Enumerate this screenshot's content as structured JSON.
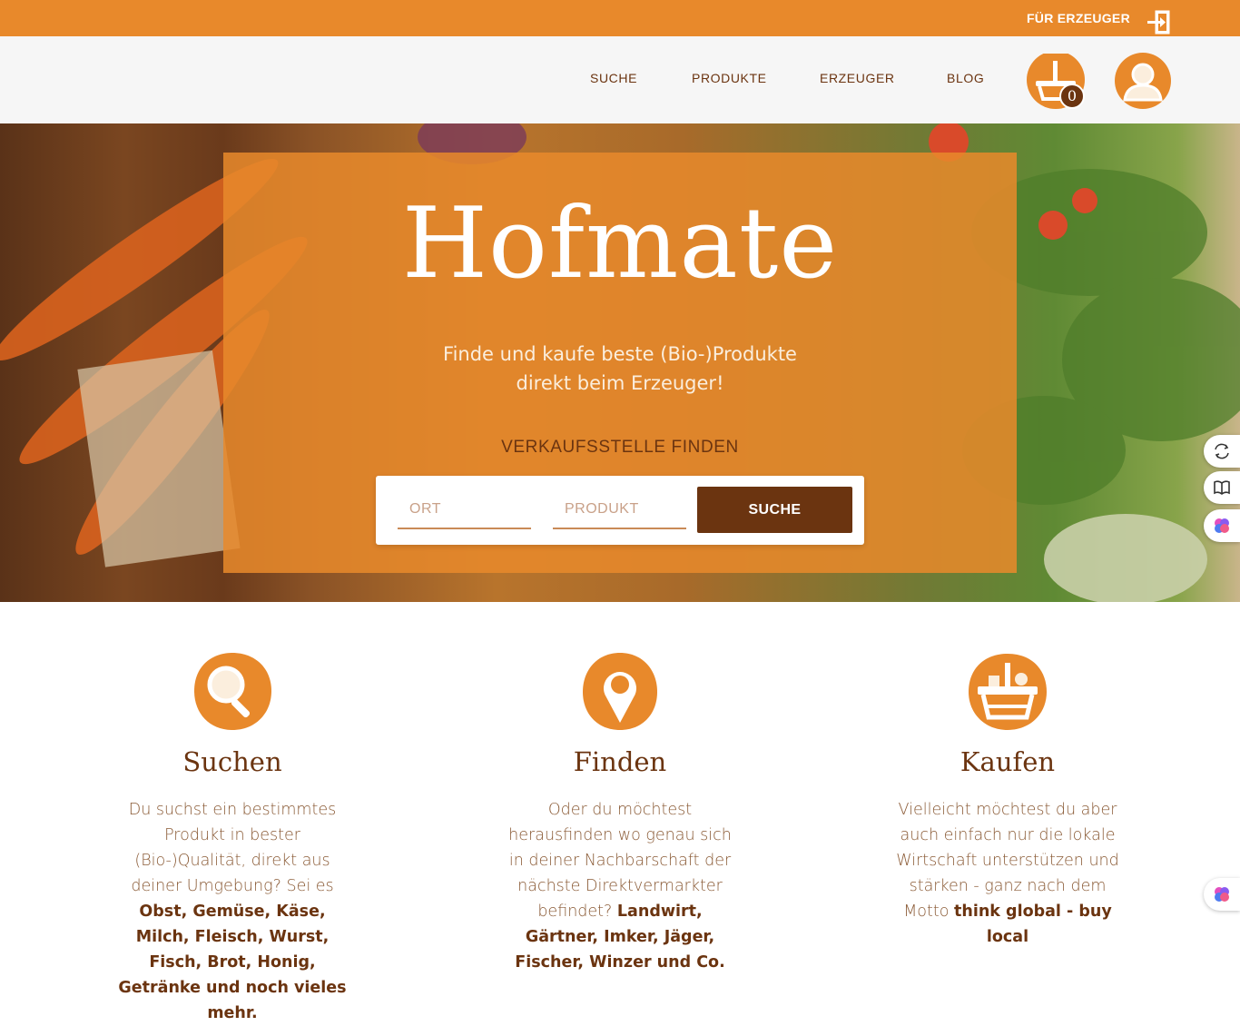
{
  "topbar": {
    "producer_link": "FÜR ERZEUGER"
  },
  "nav": {
    "items": [
      {
        "label": "SUCHE"
      },
      {
        "label": "PRODUKTE"
      },
      {
        "label": "ERZEUGER"
      },
      {
        "label": "BLOG"
      }
    ],
    "cart_count": "0"
  },
  "hero": {
    "title": "Hofmate",
    "subtitle_line1": "Finde und kaufe beste (Bio-)Produkte",
    "subtitle_line2": "direkt beim Erzeuger!",
    "find_label": "VERKAUFSSTELLE FINDEN",
    "location_placeholder": "ORT",
    "product_placeholder": "PRODUKT",
    "search_button": "SUCHE"
  },
  "features": [
    {
      "icon": "magnifier-icon",
      "title": "Suchen",
      "text": "Du suchst ein bestimmtes Produkt in bester (Bio-)Qualität, direkt aus deiner Umgebung? Sei es",
      "bold": "Obst, Gemüse, Käse, Milch, Fleisch, Wurst, Fisch, Brot, Honig, Getränke und noch vieles mehr."
    },
    {
      "icon": "map-pin-icon",
      "title": "Finden",
      "text": "Oder du möchtest herausfinden wo genau sich in deiner Nachbarschaft der nächste Direktvermarkter befindet?",
      "bold": "Landwirt, Gärtner, Imker, Jäger, Fischer, Winzer und Co."
    },
    {
      "icon": "basket-icon",
      "title": "Kaufen",
      "text": "Vielleicht möchtest du aber auch einfach nur die lokale Wirtschaft unterstützen und stärken - ganz nach dem Motto",
      "bold": "think global - buy local"
    }
  ],
  "colors": {
    "brand_orange": "#e8892b",
    "brand_brown": "#6b3410",
    "nav_bg": "#f6f6f6"
  }
}
